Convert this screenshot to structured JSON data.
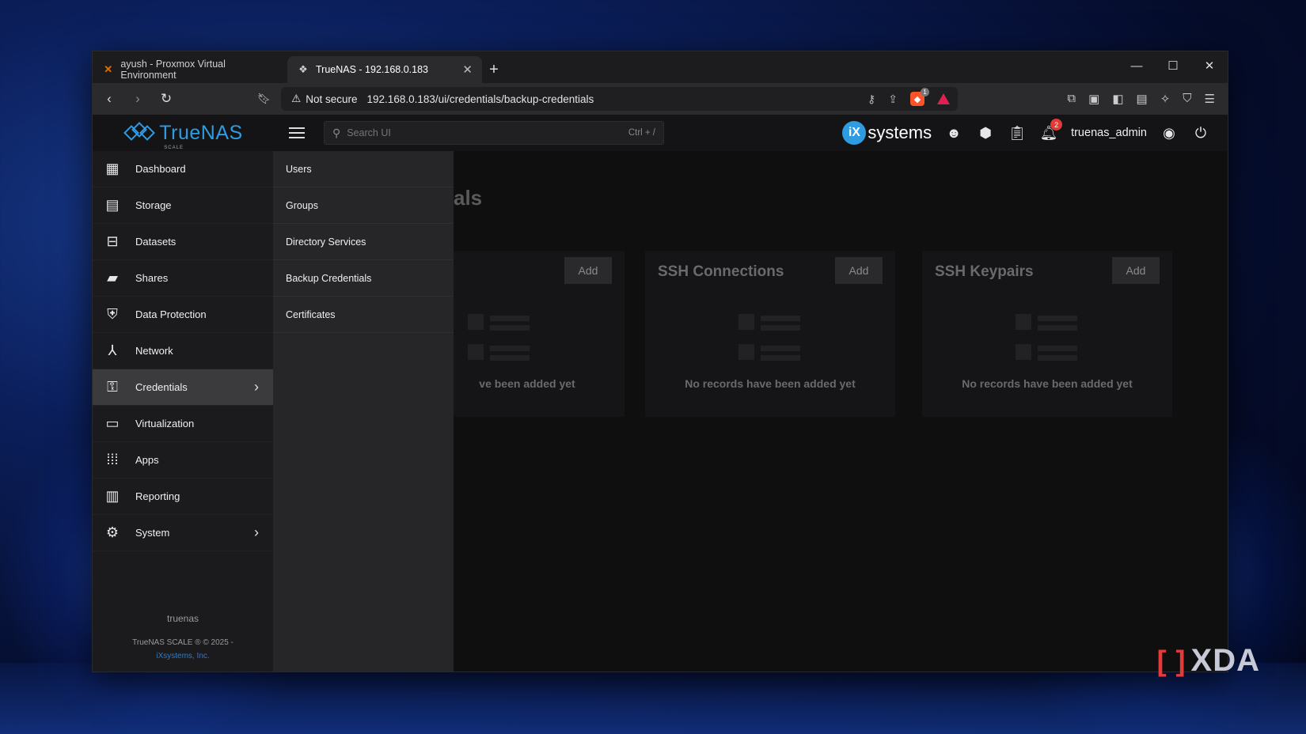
{
  "browser": {
    "tabs": [
      {
        "title": "ayush - Proxmox Virtual Environment",
        "favicon": "proxmox-icon",
        "active": false
      },
      {
        "title": "TrueNAS - 192.168.0.183",
        "favicon": "truenas-icon",
        "active": true
      }
    ],
    "new_tab": "+",
    "security_label": "Not secure",
    "url": "192.168.0.183/ui/credentials/backup-credentials"
  },
  "app": {
    "logo_text": "TrueNAS",
    "logo_sub": "SCALE",
    "search_placeholder": "Search UI",
    "search_shortcut": "Ctrl + /",
    "vendor": "systems",
    "vendor_mark": "iX",
    "notification_count": "2",
    "username": "truenas_admin"
  },
  "sidebar": {
    "items": [
      {
        "label": "Dashboard",
        "icon": "dashboard-icon"
      },
      {
        "label": "Storage",
        "icon": "storage-icon"
      },
      {
        "label": "Datasets",
        "icon": "datasets-icon"
      },
      {
        "label": "Shares",
        "icon": "shares-icon"
      },
      {
        "label": "Data Protection",
        "icon": "shield-icon"
      },
      {
        "label": "Network",
        "icon": "network-icon"
      },
      {
        "label": "Credentials",
        "icon": "key-icon",
        "active": true
      },
      {
        "label": "Virtualization",
        "icon": "laptop-icon"
      },
      {
        "label": "Apps",
        "icon": "apps-grid-icon"
      },
      {
        "label": "Reporting",
        "icon": "chart-icon"
      },
      {
        "label": "System",
        "icon": "gear-icon"
      }
    ],
    "hostname": "truenas",
    "copyright": "TrueNAS SCALE ® © 2025 -",
    "company": "iXsystems, Inc."
  },
  "submenu": {
    "items": [
      "Users",
      "Groups",
      "Directory Services",
      "Backup Credentials",
      "Certificates"
    ]
  },
  "content": {
    "title_fragment": "als",
    "cards": [
      {
        "title": "",
        "add_label": "Add",
        "empty_text": "ve been added yet"
      },
      {
        "title": "SSH Connections",
        "add_label": "Add",
        "empty_text": "No records have been added yet"
      },
      {
        "title": "SSH Keypairs",
        "add_label": "Add",
        "empty_text": "No records have been added yet"
      }
    ]
  },
  "watermark": "XDA"
}
